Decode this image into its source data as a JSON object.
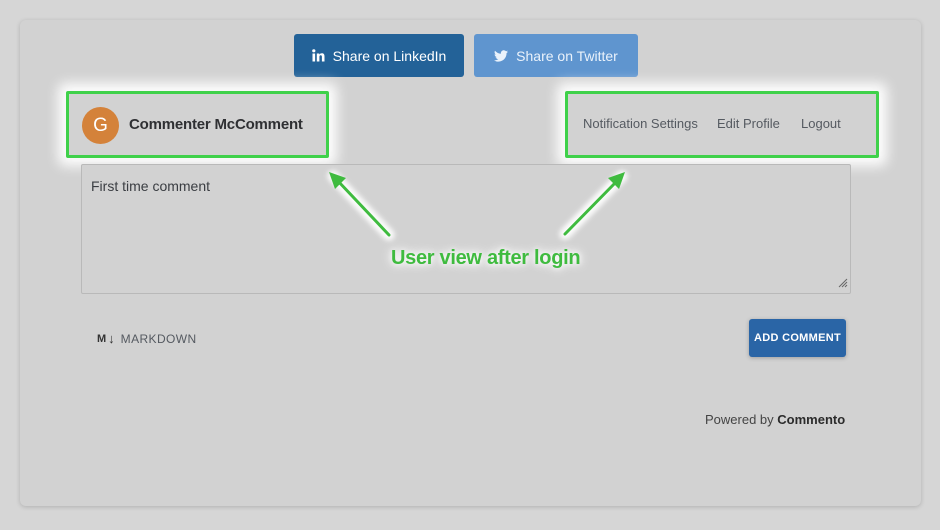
{
  "share": {
    "linkedin_label": "Share on LinkedIn",
    "twitter_label": "Share on Twitter"
  },
  "user": {
    "avatar_initial": "G",
    "name": "Commenter McComment"
  },
  "menu": {
    "notification_settings": "Notification Settings",
    "edit_profile": "Edit Profile",
    "logout": "Logout"
  },
  "comment": {
    "value": "First time comment"
  },
  "markdown": {
    "icon_text": "M",
    "label": "MARKDOWN"
  },
  "actions": {
    "add_comment": "ADD COMMENT"
  },
  "footer": {
    "powered_by": "Powered by",
    "brand": "Commento"
  },
  "annotation": {
    "text": "User view after login"
  },
  "colors": {
    "linkedin": "#236298",
    "twitter": "#5f95cf",
    "accent": "#2a65a6",
    "highlight": "#3fd14a",
    "avatar": "#d4823a"
  }
}
